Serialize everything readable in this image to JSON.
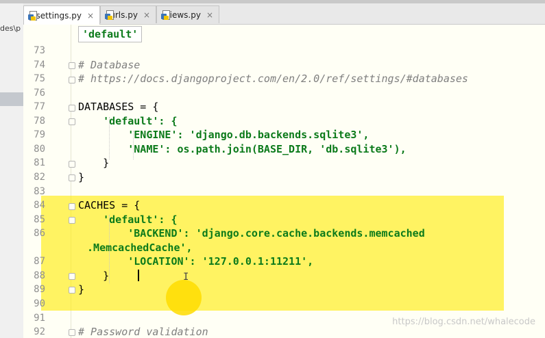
{
  "left_panel": {
    "fragment": "des\\p"
  },
  "tabs": [
    {
      "label": "settings.py",
      "active": true
    },
    {
      "label": "urls.py",
      "active": false
    },
    {
      "label": "views.py",
      "active": false
    }
  ],
  "tab_close_glyph": "×",
  "breadcrumb": "'default'",
  "lines": [
    {
      "num": "73",
      "text": ""
    },
    {
      "num": "74",
      "text": "# Database"
    },
    {
      "num": "75",
      "text": "# https://docs.djangoproject.com/en/2.0/ref/settings/#databases"
    },
    {
      "num": "76",
      "text": ""
    },
    {
      "num": "77",
      "text": "DATABASES = {"
    },
    {
      "num": "78",
      "text": "    'default': {"
    },
    {
      "num": "79",
      "text": "        'ENGINE': 'django.db.backends.sqlite3',"
    },
    {
      "num": "80",
      "text": "        'NAME': os.path.join(BASE_DIR, 'db.sqlite3'),"
    },
    {
      "num": "81",
      "text": "    }"
    },
    {
      "num": "82",
      "text": "}"
    },
    {
      "num": "83",
      "text": ""
    },
    {
      "num": "84",
      "text": "CACHES = {"
    },
    {
      "num": "85",
      "text": "    'default': {"
    },
    {
      "num": "86",
      "text": "        'BACKEND': 'django.core.cache.backends.memcached"
    },
    {
      "num": "",
      "text": " .MemcachedCache',"
    },
    {
      "num": "87",
      "text": "        'LOCATION': '127.0.0.1:11211',"
    },
    {
      "num": "88",
      "text": "    }"
    },
    {
      "num": "89",
      "text": "}"
    },
    {
      "num": "90",
      "text": ""
    },
    {
      "num": "91",
      "text": ""
    },
    {
      "num": "92",
      "text": "# Password validation"
    }
  ],
  "watermark": "https://blog.csdn.net/whalecode",
  "colors": {
    "highlight": "#fff200",
    "string": "#0b7a1a",
    "comment": "#7f7f7f"
  }
}
